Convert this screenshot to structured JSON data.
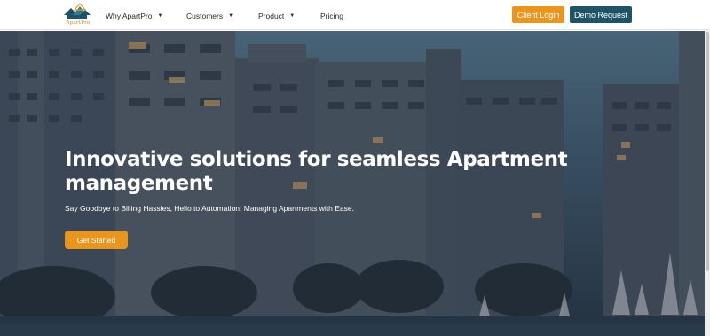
{
  "brand": {
    "logo_text": "ApartPro"
  },
  "nav": {
    "items": [
      {
        "label": "Why ApartPro",
        "has_dropdown": true
      },
      {
        "label": "Customers",
        "has_dropdown": true
      },
      {
        "label": "Product",
        "has_dropdown": true
      },
      {
        "label": "Pricing",
        "has_dropdown": false
      }
    ],
    "client_login": "Client Login",
    "demo_request": "Demo Request"
  },
  "hero": {
    "title": "Innovative solutions for seamless Apartment management",
    "subtitle": "Say Goodbye to Billing Hassles, Hello to Automation: Managing Apartments with Ease.",
    "cta": "Get Started"
  },
  "colors": {
    "accent_orange": "#e8961e",
    "accent_teal": "#1f5466"
  }
}
